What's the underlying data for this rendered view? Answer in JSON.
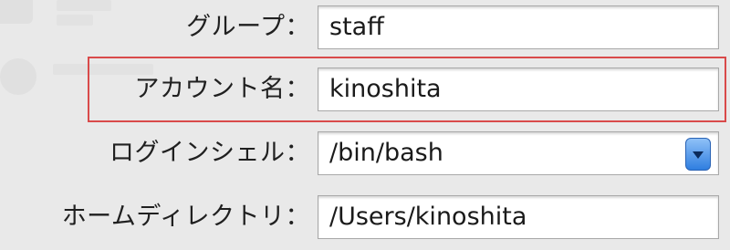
{
  "fields": [
    {
      "label": "グループ：",
      "value": "staff",
      "type": "text"
    },
    {
      "label": "アカウント名：",
      "value": "kinoshita",
      "type": "text",
      "highlighted": true
    },
    {
      "label": "ログインシェル：",
      "value": "/bin/bash",
      "type": "select"
    },
    {
      "label": "ホームディレクトリ：",
      "value": "/Users/kinoshita",
      "type": "text"
    }
  ],
  "colors": {
    "highlight_border": "#d94a4a",
    "select_accent": "#2f7ee0"
  }
}
